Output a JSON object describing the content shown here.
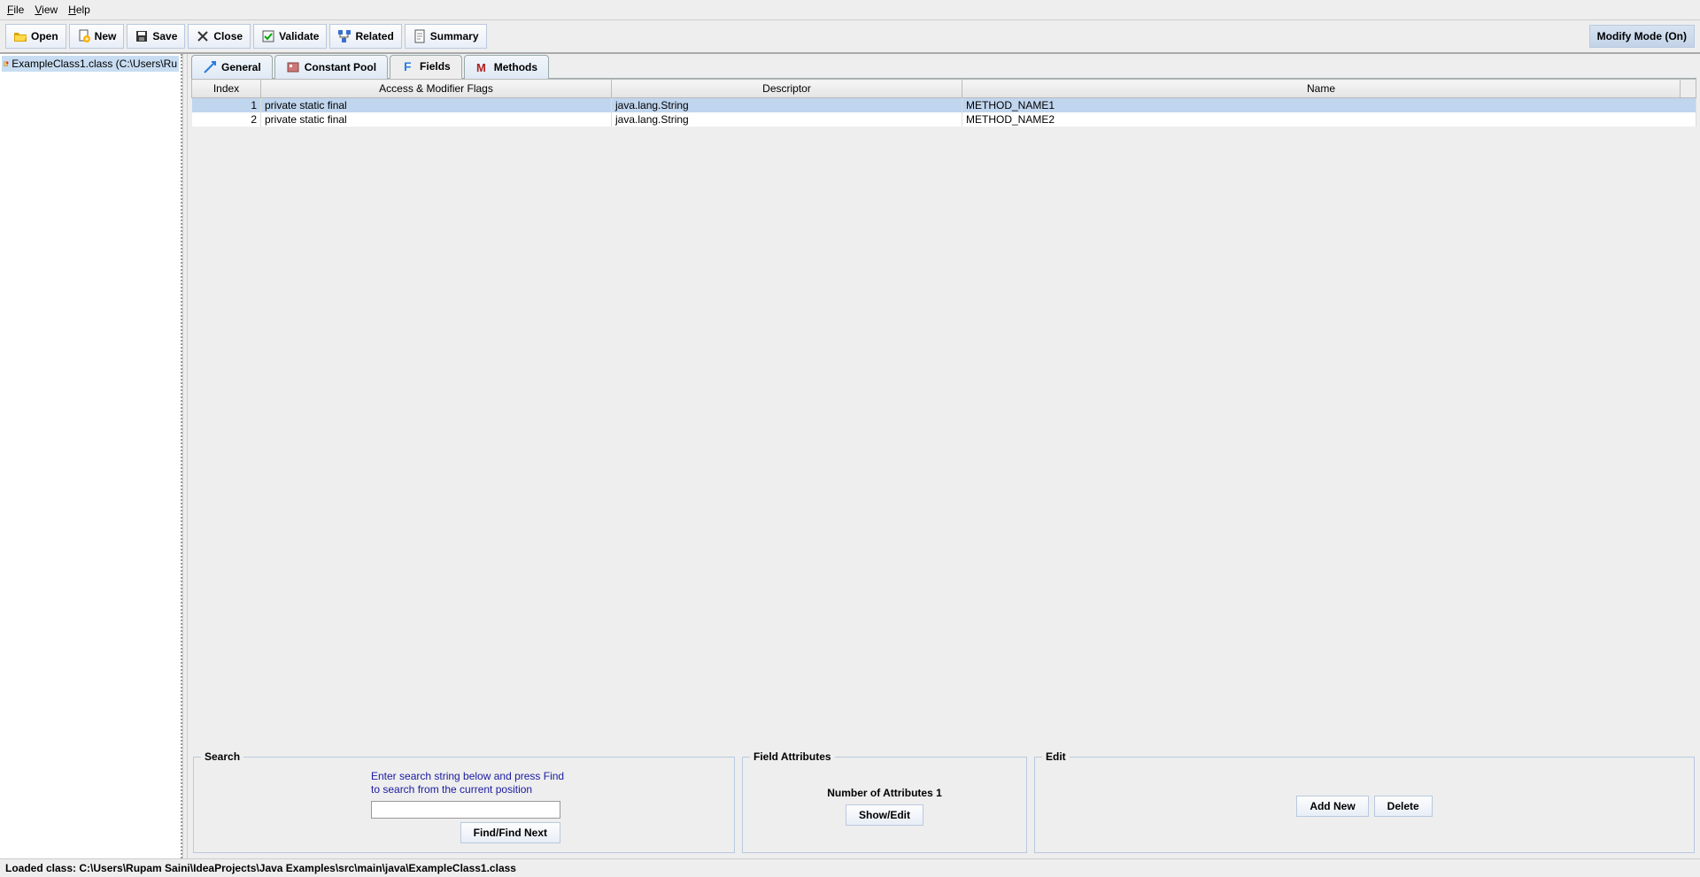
{
  "menubar": {
    "file": "File",
    "view": "View",
    "help": "Help"
  },
  "toolbar": {
    "open": "Open",
    "new": "New",
    "save": "Save",
    "close": "Close",
    "validate": "Validate",
    "related": "Related",
    "summary": "Summary",
    "modify": "Modify Mode (On)"
  },
  "sidebar": {
    "tree_item": "ExampleClass1.class (C:\\Users\\Ru"
  },
  "tabs": {
    "general": "General",
    "constant_pool": "Constant Pool",
    "fields": "Fields",
    "methods": "Methods"
  },
  "table": {
    "headers": {
      "index": "Index",
      "flags": "Access & Modifier Flags",
      "descriptor": "Descriptor",
      "name": "Name"
    },
    "rows": [
      {
        "index": "1",
        "flags": "private static final",
        "descriptor": "java.lang.String",
        "name": "METHOD_NAME1",
        "selected": true
      },
      {
        "index": "2",
        "flags": "private static final",
        "descriptor": "java.lang.String",
        "name": "METHOD_NAME2",
        "selected": false
      }
    ]
  },
  "panels": {
    "search": {
      "title": "Search",
      "hint1": "Enter search string below and press Find",
      "hint2": "to search from the current position",
      "find_btn": "Find/Find Next"
    },
    "attrs": {
      "title": "Field Attributes",
      "count_label": "Number of Attributes",
      "count_value": "1",
      "show_edit": "Show/Edit"
    },
    "edit": {
      "title": "Edit",
      "add_new": "Add New",
      "delete": "Delete"
    }
  },
  "statusbar": "Loaded class: C:\\Users\\Rupam Saini\\IdeaProjects\\Java Examples\\src\\main\\java\\ExampleClass1.class"
}
